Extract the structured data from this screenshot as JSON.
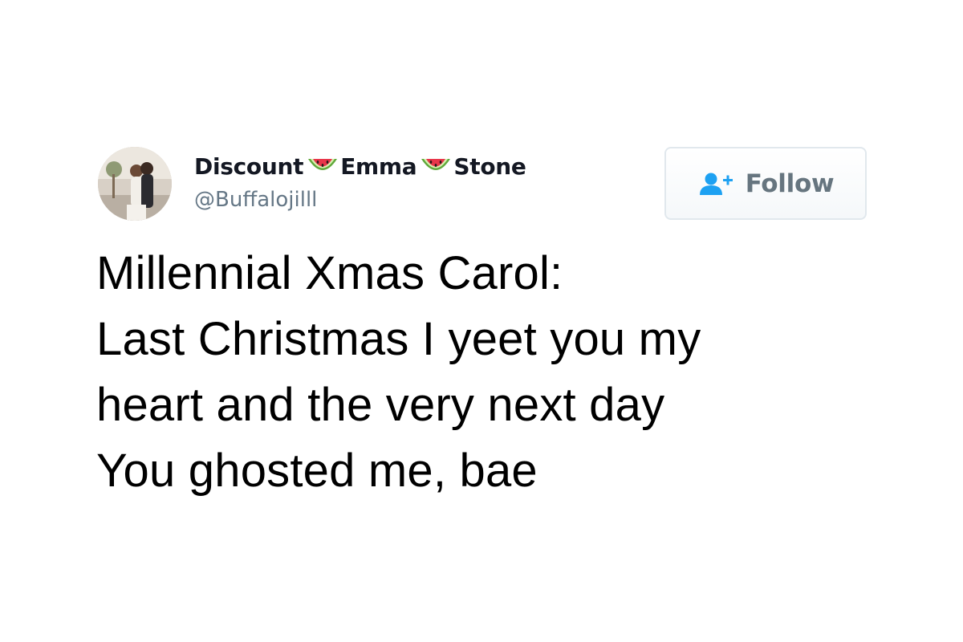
{
  "author": {
    "name_parts": [
      "Discount",
      "Emma",
      "Stone"
    ],
    "name_separator_icon": "watermelon-icon",
    "handle": "@Buffalojilll",
    "avatar_icon": "profile-photo"
  },
  "follow_button": {
    "label": "Follow",
    "icon": "add-user-icon"
  },
  "tweet": {
    "lines": [
      "Millennial Xmas Carol:",
      "Last Christmas I yeet you my",
      "heart and the very next day",
      "You ghosted me, bae"
    ]
  },
  "colors": {
    "name": "#141823",
    "handle": "#657786",
    "follow_icon": "#1da1f2",
    "follow_label": "#66757f",
    "follow_border": "#e1e8ed",
    "tweet_text": "#000000",
    "background": "#ffffff"
  }
}
